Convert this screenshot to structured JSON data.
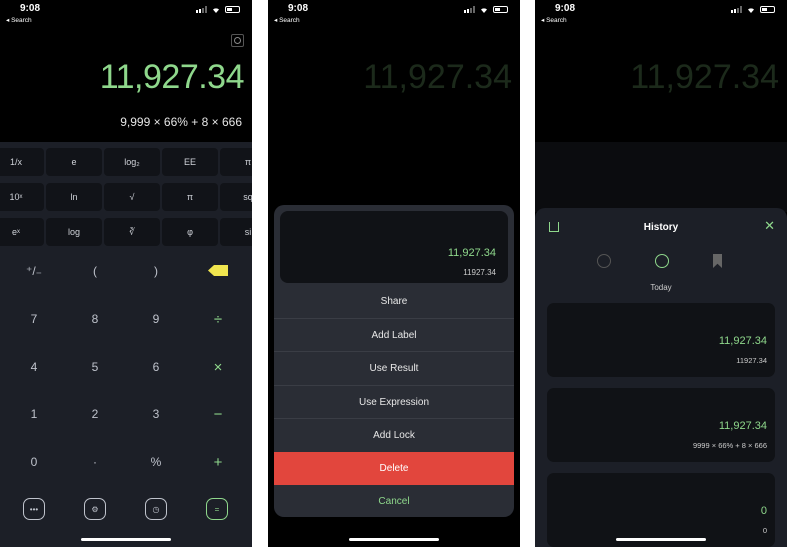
{
  "status": {
    "time": "9:08",
    "back": "◂ Search"
  },
  "calc": {
    "result": "11,927.34",
    "expression": "9,999 × 66% + 8 × 666",
    "sci_rows": [
      [
        "1/x",
        "e",
        "log₂",
        "EE",
        "π"
      ],
      [
        "10ˣ",
        "ln",
        "√",
        "π",
        "sq"
      ],
      [
        "eˣ",
        "log",
        "∛",
        "φ",
        "si"
      ]
    ],
    "basic_rows": [
      [
        "⁺/₋",
        "(",
        ")",
        ""
      ],
      [
        "7",
        "8",
        "9",
        "÷"
      ],
      [
        "4",
        "5",
        "6",
        "×"
      ],
      [
        "1",
        "2",
        "3",
        "−"
      ],
      [
        "0",
        "·",
        "%",
        "+"
      ]
    ],
    "bottom": [
      "•••",
      "⚙",
      "◷",
      "="
    ]
  },
  "actions": {
    "preview_value": "11,927.34",
    "preview_raw": "11927.34",
    "items": [
      "Share",
      "Add Label",
      "Use Result",
      "Use Expression",
      "Add Lock"
    ],
    "delete": "Delete",
    "cancel": "Cancel"
  },
  "history": {
    "title": "History",
    "close": "✕",
    "section": "Today",
    "cards": [
      {
        "value": "11,927.34",
        "detail": "11927.34"
      },
      {
        "value": "11,927.34",
        "detail": "9999 × 66% + 8 × 666"
      },
      {
        "value": "0",
        "detail": "0"
      }
    ]
  }
}
